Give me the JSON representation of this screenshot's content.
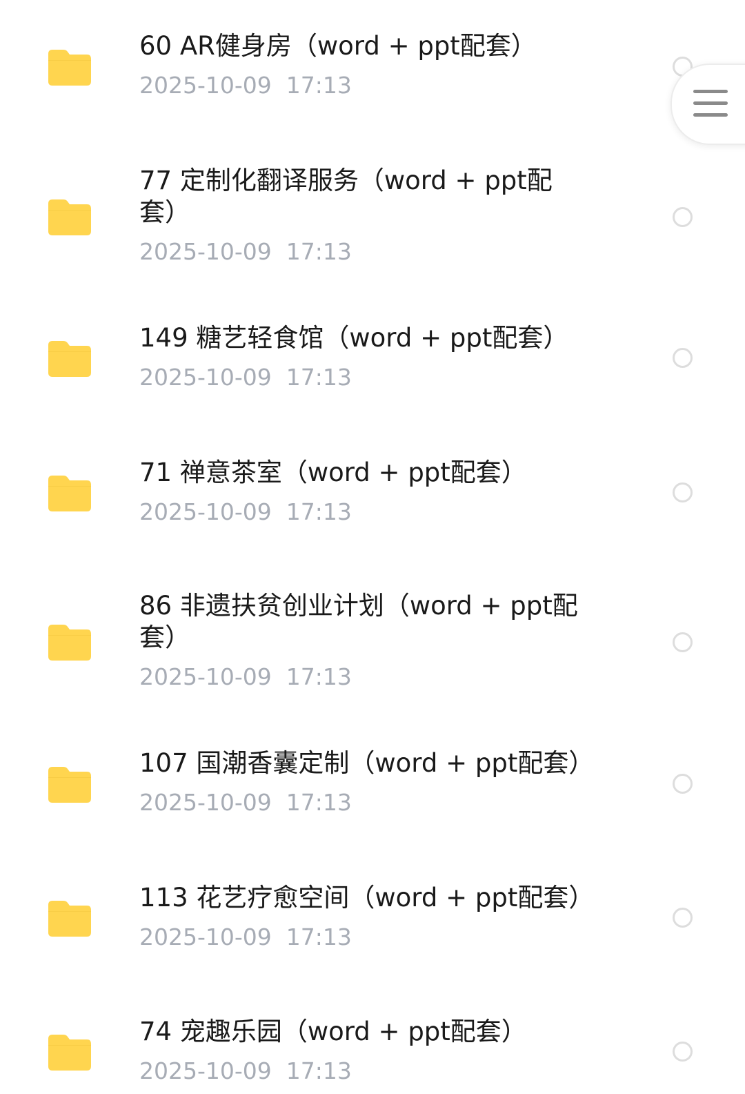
{
  "files": [
    {
      "title": "60  AR健身房（word + ppt配套）",
      "date": "2025-10-09  17:13"
    },
    {
      "title": "77  定制化翻译服务（word + ppt配套）",
      "date": "2025-10-09  17:13"
    },
    {
      "title": "149  糖艺轻食馆（word + ppt配套）",
      "date": "2025-10-09  17:13"
    },
    {
      "title": "71  禅意茶室（word + ppt配套）",
      "date": "2025-10-09  17:13"
    },
    {
      "title": "86  非遗扶贫创业计划（word + ppt配套）",
      "date": "2025-10-09  17:13"
    },
    {
      "title": "107  国潮香囊定制（word + ppt配套）",
      "date": "2025-10-09  17:13"
    },
    {
      "title": "113  花艺疗愈空间（word + ppt配套）",
      "date": "2025-10-09  17:13"
    },
    {
      "title": "74  宠趣乐园（word + ppt配套）",
      "date": "2025-10-09  17:13"
    }
  ],
  "icons": {
    "item": "folder-icon",
    "select": "radio-unchecked-icon",
    "menu": "hamburger-menu-icon"
  },
  "colors": {
    "folder": "#FFD54F",
    "title": "#1A1A1A",
    "date": "#A7ACB5",
    "radio": "#DDDDDD"
  }
}
